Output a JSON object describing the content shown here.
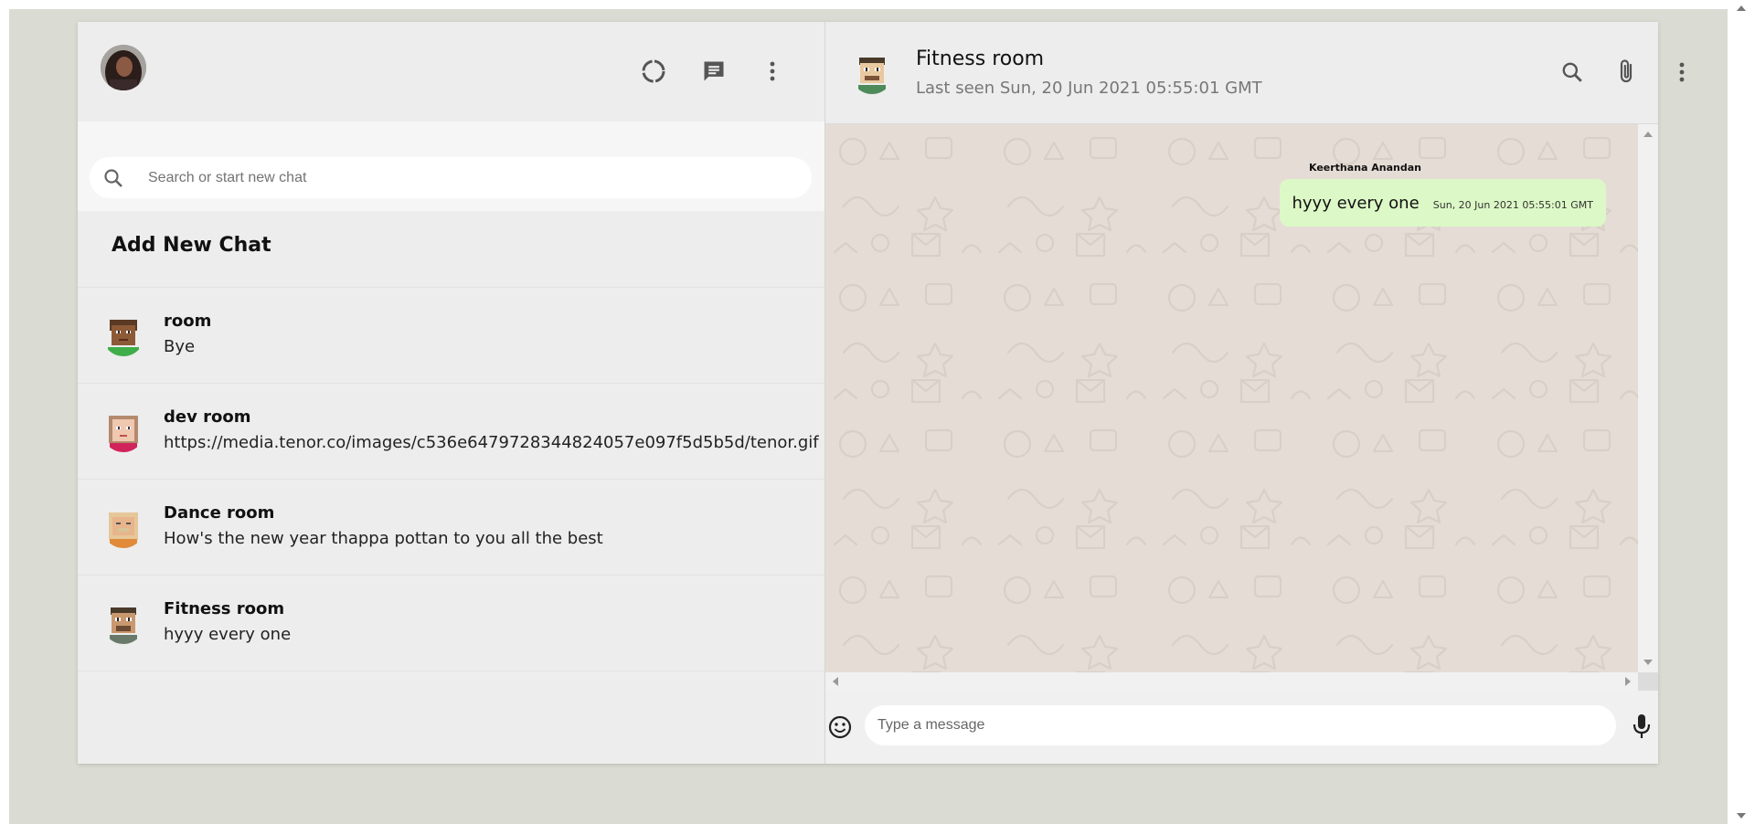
{
  "sidebar": {
    "search": {
      "placeholder": "Search or start new chat"
    },
    "add_new_chat_label": "Add New Chat",
    "chats": [
      {
        "name": "room",
        "last_message": "Bye"
      },
      {
        "name": "dev room",
        "last_message": "https://media.tenor.co/images/c536e6479728344824057e097f5d5b5d/tenor.gif"
      },
      {
        "name": "Dance room",
        "last_message": "How's the new year thappa pottan to you all the best"
      },
      {
        "name": "Fitness room",
        "last_message": "hyyy every one"
      }
    ]
  },
  "chat": {
    "title": "Fitness room",
    "subtitle": "Last seen Sun, 20 Jun 2021 05:55:01 GMT",
    "messages": [
      {
        "sender": "Keerthana Anandan",
        "text": "hyyy every one",
        "time": "Sun, 20 Jun 2021 05:55:01 GMT"
      }
    ],
    "input_placeholder": "Type a message"
  },
  "icons": {
    "status": "status-icon",
    "new_chat": "chat-icon",
    "menu": "more-vert-icon",
    "search": "search-icon",
    "attach": "attach-icon",
    "emoji": "emoji-icon",
    "mic": "mic-icon"
  },
  "colors": {
    "app_bg": "#ededed",
    "chat_bg": "#e5ddd5",
    "bubble": "#dcf8c6",
    "page_bg": "#dadbd3"
  }
}
